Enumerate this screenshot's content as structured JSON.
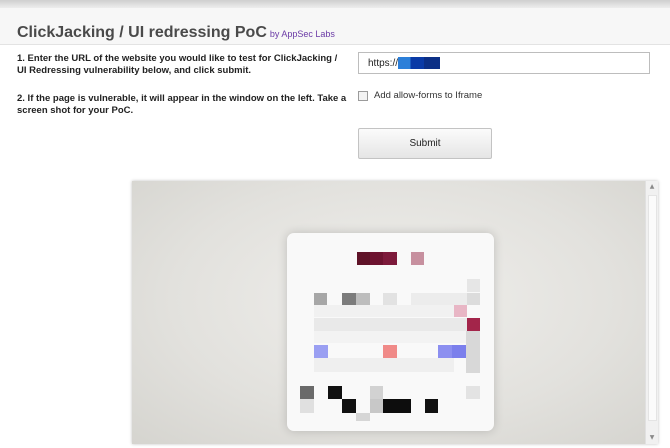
{
  "header": {
    "title": "ClickJacking / UI redressing PoC",
    "byline": "by AppSec Labs"
  },
  "instructions": {
    "step1": "1. Enter the URL of the website you would like to test for ClickJacking / UI Redressing vulnerability below, and click submit.",
    "step2": "2. If the page is vulnerable, it will appear in the window on the left. Take a screen shot for your PoC."
  },
  "form": {
    "url_value": "https://",
    "checkbox_label": "Add allow-forms to Iframe",
    "checkbox_checked": false,
    "submit_label": "Submit"
  },
  "frame": {
    "scroll_up_glyph": "▲",
    "scroll_down_glyph": "▼"
  },
  "colors": {
    "byline": "#6b3aa6",
    "redacted_url": "#0a3aa6"
  }
}
